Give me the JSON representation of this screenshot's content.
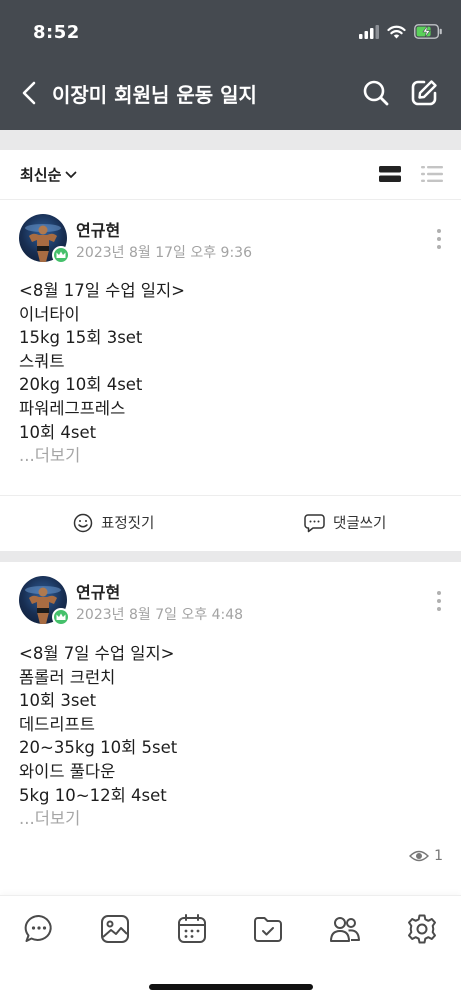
{
  "status_bar": {
    "time": "8:52",
    "icons": [
      "signal-icon",
      "wifi-icon",
      "battery-charging-icon"
    ]
  },
  "nav": {
    "title": "이장미 회원님 운동 일지",
    "back_icon": "chevron-left-icon",
    "search_icon": "search-icon",
    "write_icon": "edit-icon"
  },
  "sort": {
    "label": "최신순",
    "view_options": [
      "card-view-icon",
      "list-view-icon"
    ]
  },
  "posts": [
    {
      "author": "연규현",
      "date": "2023년 8월 17일 오후 9:36",
      "lines": [
        "<8월 17일 수업 일지>",
        "이너타이",
        "15kg 15회 3set",
        "스쿼트",
        "20kg 10회 4set",
        "파워레그프레스",
        "10회 4set"
      ],
      "read_more": "...더보기"
    },
    {
      "author": "연규현",
      "date": "2023년 8월 7일 오후 4:48",
      "lines": [
        "<8월 7일 수업 일지>",
        "폼롤러 크런치",
        "10회 3set",
        "데드리프트",
        "20~35kg 10회 5set",
        "와이드 풀다운",
        "5kg 10~12회 4set"
      ],
      "read_more": "...더보기",
      "views": "1"
    }
  ],
  "actions": {
    "react_label": "표정짓기",
    "comment_label": "댓글쓰기"
  },
  "tab_bar": {
    "tabs": [
      "chat-icon",
      "photo-icon",
      "calendar-icon",
      "folder-check-icon",
      "members-icon",
      "settings-icon"
    ]
  },
  "colors": {
    "header_bg": "#454a50",
    "badge_green": "#45c06b",
    "divider_gray": "#e9e9ea"
  }
}
